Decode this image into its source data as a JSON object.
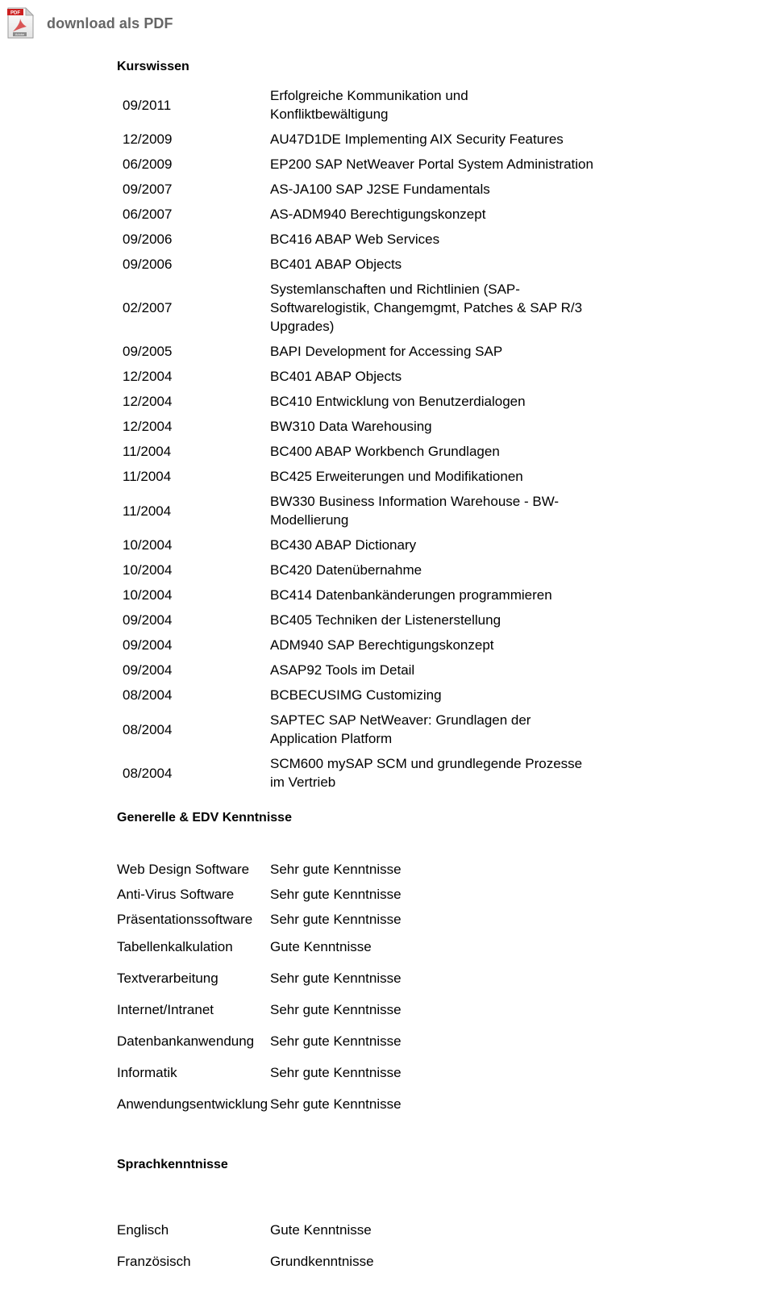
{
  "download": {
    "label": "download als PDF",
    "icon": "pdf-file-icon",
    "icon_badge": "PDF",
    "icon_brand": "Adobe",
    "text_color": "#666666"
  },
  "sections": {
    "courses": {
      "heading": "Kurswissen",
      "rows": [
        {
          "date": "09/2011",
          "lines": [
            "Erfolgreiche Kommunikation und",
            "Konfliktbewältigung"
          ]
        },
        {
          "date": "12/2009",
          "lines": [
            "AU47D1DE Implementing AIX Security Features"
          ]
        },
        {
          "date": "06/2009",
          "lines": [
            "EP200 SAP NetWeaver Portal System Administration"
          ]
        },
        {
          "date": "09/2007",
          "lines": [
            "AS-JA100 SAP J2SE Fundamentals"
          ]
        },
        {
          "date": "06/2007",
          "lines": [
            "AS-ADM940 Berechtigungskonzept"
          ]
        },
        {
          "date": "09/2006",
          "lines": [
            "BC416 ABAP Web Services"
          ]
        },
        {
          "date": "09/2006",
          "lines": [
            "BC401 ABAP Objects"
          ]
        },
        {
          "date": "02/2007",
          "lines": [
            "Systemlanschaften und Richtlinien (SAP-",
            "Softwarelogistik, Changemgmt, Patches & SAP R/3",
            "Upgrades)"
          ]
        },
        {
          "date": "09/2005",
          "lines": [
            "BAPI Development for Accessing SAP"
          ]
        },
        {
          "date": "12/2004",
          "lines": [
            "BC401 ABAP Objects"
          ]
        },
        {
          "date": "12/2004",
          "lines": [
            "BC410 Entwicklung von Benutzerdialogen"
          ]
        },
        {
          "date": "12/2004",
          "lines": [
            "BW310 Data Warehousing"
          ]
        },
        {
          "date": "11/2004",
          "lines": [
            "BC400 ABAP Workbench Grundlagen"
          ]
        },
        {
          "date": "11/2004",
          "lines": [
            "BC425 Erweiterungen und Modifikationen"
          ]
        },
        {
          "date": "11/2004",
          "lines": [
            "BW330 Business Information Warehouse - BW-",
            "Modellierung"
          ]
        },
        {
          "date": "10/2004",
          "lines": [
            "BC430 ABAP Dictionary"
          ]
        },
        {
          "date": "10/2004",
          "lines": [
            "BC420 Datenübernahme"
          ]
        },
        {
          "date": "10/2004",
          "lines": [
            "BC414 Datenbankänderungen programmieren"
          ]
        },
        {
          "date": "09/2004",
          "lines": [
            "BC405 Techniken der Listenerstellung"
          ]
        },
        {
          "date": "09/2004",
          "lines": [
            "ADM940 SAP Berechtigungskonzept"
          ]
        },
        {
          "date": "09/2004",
          "lines": [
            "ASAP92 Tools im Detail"
          ]
        },
        {
          "date": "08/2004",
          "lines": [
            "BCBECUSIMG Customizing"
          ]
        },
        {
          "date": "08/2004",
          "lines": [
            "SAPTEC SAP NetWeaver: Grundlagen der",
            "Application Platform"
          ]
        },
        {
          "date": "08/2004",
          "lines": [
            "SCM600 mySAP SCM und grundlegende Prozesse",
            "im Vertrieb"
          ]
        }
      ]
    },
    "it_skills": {
      "heading": "Generelle & EDV Kenntnisse",
      "rows": [
        {
          "skill": "Web Design Software",
          "level": "Sehr gute Kenntnisse"
        },
        {
          "skill": "Anti-Virus Software",
          "level": "Sehr gute Kenntnisse"
        },
        {
          "skill": "Präsentationssoftware",
          "level": "Sehr gute Kenntnisse"
        },
        {
          "skill": "Tabellenkalkulation",
          "level": "Gute Kenntnisse"
        },
        {
          "skill": "Textverarbeitung",
          "level": "Sehr gute Kenntnisse"
        },
        {
          "skill": "Internet/Intranet",
          "level": "Sehr gute Kenntnisse"
        },
        {
          "skill": "Datenbankanwendung",
          "level": "Sehr gute Kenntnisse"
        },
        {
          "skill": "Informatik",
          "level": "Sehr gute Kenntnisse"
        },
        {
          "skill": "Anwendungsentwicklung",
          "level": "Sehr gute Kenntnisse"
        }
      ]
    },
    "languages": {
      "heading": "Sprachkenntnisse",
      "rows": [
        {
          "language": "Englisch",
          "level": "Gute Kenntnisse"
        },
        {
          "language": "Französisch",
          "level": "Grundkenntnisse"
        }
      ]
    }
  }
}
